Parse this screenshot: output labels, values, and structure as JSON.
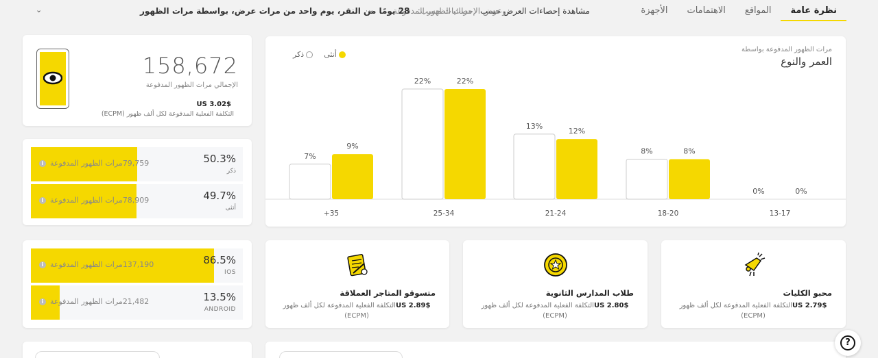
{
  "tabs": [
    "نظرة عامة",
    "المواقع",
    "الاهتمامات",
    "الأجهزة"
  ],
  "filters": {
    "view_label": "مشاهدة إحصاءات العرض حسب",
    "view_value": "مرات الظهور المدفوعة",
    "window_label": "وعرض الإحصائيات حسب:",
    "window_value": "28 يومًا من النقر، يوم واحد من مرات عرض، بواسطة مرات الظهور"
  },
  "summary": {
    "total": "158,672",
    "total_label": "الإجمالي مرات الظهور المدفوعة",
    "ecpm_value": "$US 3.02",
    "ecpm_label": "التكلفة الفعلية المدفوعة لكل ألف ظهور (ECPM)"
  },
  "gender": [
    {
      "pct": "50.3%",
      "label": "ذكر",
      "count": "79,759مرات الظهور المدفوعة",
      "fraction": 0.503
    },
    {
      "pct": "49.7%",
      "label": "أنثى",
      "count": "78,909مرات الظهور المدفوعة",
      "fraction": 0.497
    }
  ],
  "device": [
    {
      "pct": "86.5%",
      "label": "IOS",
      "count": "137,190مرات الظهور المدفوعة",
      "fraction": 0.865
    },
    {
      "pct": "13.5%",
      "label": "ANDROID",
      "count": "21,482مرات الظهور المدفوعة",
      "fraction": 0.135
    }
  ],
  "chart": {
    "subtitle": "مرات الظهور المدفوعة بواسطة",
    "title": "العمر والنوع",
    "legend_female": "أنثى",
    "legend_male": "ذكر"
  },
  "chart_data": {
    "type": "bar",
    "categories": [
      "+35",
      "25-34",
      "21-24",
      "18-20",
      "13-17"
    ],
    "series": [
      {
        "name": "ذكر",
        "values": [
          7,
          22,
          13,
          8,
          0
        ],
        "color": "#ffffff"
      },
      {
        "name": "أنثى",
        "values": [
          9,
          22,
          12,
          8,
          0
        ],
        "color": "#f5d800"
      }
    ],
    "value_labels_male": [
      "7%",
      "22%",
      "13%",
      "8%",
      "0%"
    ],
    "value_labels_female": [
      "9%",
      "22%",
      "12%",
      "8%",
      "0%"
    ],
    "ylim": [
      0,
      25
    ],
    "legend": "top-left"
  },
  "segments": [
    {
      "title": "محبو الكليات",
      "ecpm_value": "$US 2.79",
      "ecpm_label": "التكلفة الفعلية المدفوعة لكل ألف ظهور (ECPM)",
      "icon": "bugle-icon"
    },
    {
      "title": "طلاب المدارس الثانوية",
      "ecpm_value": "$US 2.80",
      "ecpm_label": "التكلفة الفعلية المدفوعة لكل ألف ظهور (ECPM)",
      "icon": "medal-icon"
    },
    {
      "title": "متسوقو المتاجر العملاقة",
      "ecpm_value": "$US 2.89",
      "ecpm_label": "التكلفة الفعلية المدفوعة لكل ألف ظهور (ECPM)",
      "icon": "receipt-icon"
    }
  ],
  "colors": {
    "accent": "#f5d800",
    "background": "#f2f2f2"
  }
}
